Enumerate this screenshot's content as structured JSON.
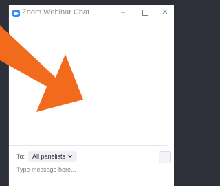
{
  "window": {
    "title": "Zoom Webinar Chat",
    "controls": {
      "minimize_icon": "minimize-icon",
      "maximize_icon": "maximize-icon",
      "close_icon": "close-icon"
    }
  },
  "composer": {
    "to_label": "To:",
    "recipient": "All panelists",
    "more_icon": "more-options-icon",
    "message_placeholder": "Type message here..."
  },
  "annotation": {
    "arrow_color": "#f26a1b",
    "arrow_icon": "orange-arrow-annotation"
  },
  "colors": {
    "background": "#2d3038",
    "window": "#ffffff",
    "zoom_blue": "#2d8cff"
  }
}
